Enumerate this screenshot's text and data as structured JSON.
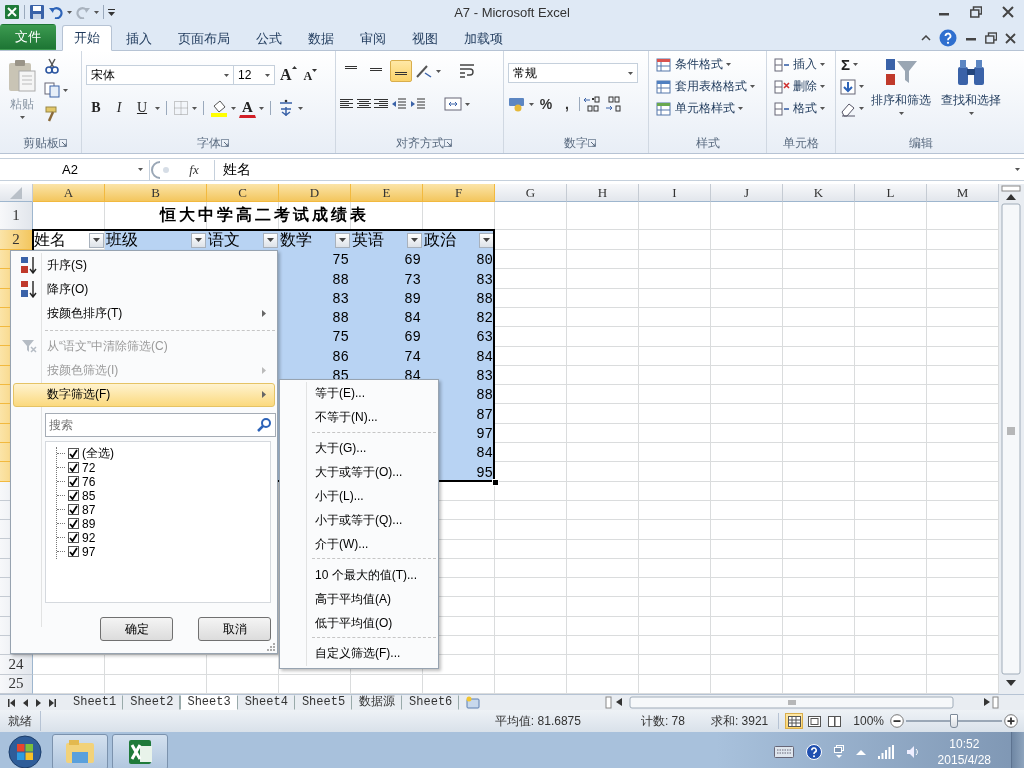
{
  "window": {
    "title": "A7  -  Microsoft Excel"
  },
  "ribbon_tabs": [
    {
      "label": "文件",
      "kind": "file",
      "selected": false
    },
    {
      "label": "开始",
      "kind": "tab",
      "selected": true
    },
    {
      "label": "插入",
      "kind": "tab",
      "selected": false
    },
    {
      "label": "页面布局",
      "kind": "tab",
      "selected": false
    },
    {
      "label": "公式",
      "kind": "tab",
      "selected": false
    },
    {
      "label": "数据",
      "kind": "tab",
      "selected": false
    },
    {
      "label": "审阅",
      "kind": "tab",
      "selected": false
    },
    {
      "label": "视图",
      "kind": "tab",
      "selected": false
    },
    {
      "label": "加载项",
      "kind": "tab",
      "selected": false
    }
  ],
  "clipboard": {
    "label": "剪贴板",
    "paste": "粘贴"
  },
  "font": {
    "label": "字体",
    "font_name": "宋体",
    "font_size": "12",
    "grow": "A",
    "shrink": "A",
    "bold": "B",
    "italic": "I",
    "underline": "U",
    "font_color": "A"
  },
  "alignment": {
    "label": "对齐方式",
    "vertical_align": [
      {
        "selected": false
      },
      {
        "selected": false
      },
      {
        "selected": true
      }
    ]
  },
  "number": {
    "label": "数字",
    "format": "常规",
    "percent": "%",
    "comma": ","
  },
  "styles": {
    "label": "样式",
    "items": [
      "条件格式",
      "套用表格格式",
      "单元格样式"
    ]
  },
  "cells": {
    "label": "单元格",
    "items": [
      "插入",
      "删除",
      "格式"
    ]
  },
  "editing": {
    "label": "编辑",
    "autosum": "Σ",
    "sort_filter": "排序和筛选",
    "find_select": "查找和选择"
  },
  "formula_bar": {
    "name_box": "A2",
    "function_label": "fx",
    "value": "姓名"
  },
  "sheet": {
    "columns": [
      {
        "label": "A",
        "selected": true
      },
      {
        "label": "B",
        "selected": true
      },
      {
        "label": "C",
        "selected": true
      },
      {
        "label": "D",
        "selected": true
      },
      {
        "label": "E",
        "selected": true
      },
      {
        "label": "F",
        "selected": true
      },
      {
        "label": "G",
        "selected": false
      },
      {
        "label": "H",
        "selected": false
      },
      {
        "label": "I",
        "selected": false
      },
      {
        "label": "J",
        "selected": false
      },
      {
        "label": "K",
        "selected": false
      },
      {
        "label": "L",
        "selected": false
      },
      {
        "label": "M",
        "selected": false
      }
    ],
    "row_headers": [
      {
        "label": "1",
        "selected": false
      },
      {
        "label": "2",
        "selected": true
      },
      {
        "selected": true
      },
      {
        "selected": true
      },
      {
        "selected": true
      },
      {
        "selected": true
      },
      {
        "selected": true
      },
      {
        "selected": true
      },
      {
        "selected": true
      },
      {
        "selected": true
      },
      {
        "selected": true
      },
      {
        "selected": true
      },
      {
        "selected": true
      },
      {
        "selected": true
      },
      {
        "selected": false
      },
      {
        "selected": false
      },
      {
        "selected": false
      },
      {
        "selected": false
      },
      {
        "selected": false
      },
      {
        "selected": false
      },
      {
        "selected": false
      },
      {
        "selected": false
      },
      {
        "selected": false
      },
      {
        "label": "24",
        "selected": false
      },
      {
        "label": "25",
        "selected": false
      }
    ],
    "title": "恒大中学高二考试成绩表",
    "headers": [
      {
        "label": "姓名",
        "selected": false
      },
      {
        "label": "班级",
        "selected": true
      },
      {
        "label": "语文",
        "selected": true
      },
      {
        "label": "数学",
        "selected": true
      },
      {
        "label": "英语",
        "selected": true
      },
      {
        "label": "政治",
        "selected": true
      }
    ],
    "rows": [
      {
        "math": "75",
        "english": "69",
        "politics": "80"
      },
      {
        "math": "88",
        "english": "73",
        "politics": "83"
      },
      {
        "math": "83",
        "english": "89",
        "politics": "88"
      },
      {
        "math": "88",
        "english": "84",
        "politics": "82"
      },
      {
        "math": "75",
        "english": "69",
        "politics": "63"
      },
      {
        "math": "86",
        "english": "74",
        "politics": "84"
      },
      {
        "math": "85",
        "english": "84",
        "politics": "83"
      },
      {
        "politics": "88"
      },
      {
        "politics": "87"
      },
      {
        "politics": "97"
      },
      {
        "politics": "84"
      },
      {
        "politics": "95"
      }
    ]
  },
  "filter_menu": {
    "items": [
      {
        "kind": "sort_asc",
        "label": "升序(S)",
        "disabled": false,
        "submenu": false,
        "selected": false
      },
      {
        "kind": "sort_desc",
        "label": "降序(O)",
        "disabled": false,
        "submenu": false,
        "selected": false
      },
      {
        "kind": "plain",
        "label": "按颜色排序(T)",
        "disabled": false,
        "submenu": true,
        "selected": false
      },
      {
        "kind": "separator"
      },
      {
        "kind": "clear_filter",
        "label": "从“语文”中清除筛选(C)",
        "disabled": true,
        "submenu": false,
        "selected": false
      },
      {
        "kind": "plain",
        "label": "按颜色筛选(I)",
        "disabled": true,
        "submenu": true,
        "selected": false
      },
      {
        "kind": "plain",
        "label": "数字筛选(F)",
        "disabled": false,
        "submenu": true,
        "selected": true
      }
    ],
    "search": {
      "placeholder": "搜索"
    },
    "values": [
      {
        "label": "(全选)",
        "checked": true
      },
      {
        "label": "72",
        "checked": true
      },
      {
        "label": "76",
        "checked": true
      },
      {
        "label": "85",
        "checked": true
      },
      {
        "label": "87",
        "checked": true
      },
      {
        "label": "89",
        "checked": true
      },
      {
        "label": "92",
        "checked": true
      },
      {
        "label": "97",
        "checked": true
      }
    ],
    "buttons": [
      "确定",
      "取消"
    ]
  },
  "submenu": {
    "items": [
      {
        "kind": "item",
        "label": "等于(E)..."
      },
      {
        "kind": "item",
        "label": "不等于(N)..."
      },
      {
        "kind": "separator"
      },
      {
        "kind": "item",
        "label": "大于(G)..."
      },
      {
        "kind": "item",
        "label": "大于或等于(O)..."
      },
      {
        "kind": "item",
        "label": "小于(L)..."
      },
      {
        "kind": "item",
        "label": "小于或等于(Q)..."
      },
      {
        "kind": "item",
        "label": "介于(W)..."
      },
      {
        "kind": "separator"
      },
      {
        "kind": "item",
        "label": "10 个最大的值(T)..."
      },
      {
        "kind": "item",
        "label": "高于平均值(A)"
      },
      {
        "kind": "item",
        "label": "低于平均值(O)"
      },
      {
        "kind": "separator"
      },
      {
        "kind": "item",
        "label": "自定义筛选(F)..."
      }
    ]
  },
  "sheet_tabs": [
    {
      "label": "Sheet1",
      "selected": false
    },
    {
      "label": "Sheet2",
      "selected": false
    },
    {
      "label": "Sheet3",
      "selected": true
    },
    {
      "label": "Sheet4",
      "selected": false
    },
    {
      "label": "Sheet5",
      "selected": false
    },
    {
      "label": "数据源",
      "selected": false
    },
    {
      "label": "Sheet6",
      "selected": false
    }
  ],
  "status_bar": {
    "ready": "就绪",
    "average": "平均值: 81.6875",
    "count": "计数: 78",
    "sum": "求和: 3921",
    "views": [
      {
        "selected": true
      },
      {
        "selected": false
      },
      {
        "selected": false
      }
    ],
    "zoom": "100%",
    "zoom_slider": {
      "level": 0.5
    }
  },
  "taskbar": {
    "time": "10:52",
    "date": "2015/4/28"
  }
}
